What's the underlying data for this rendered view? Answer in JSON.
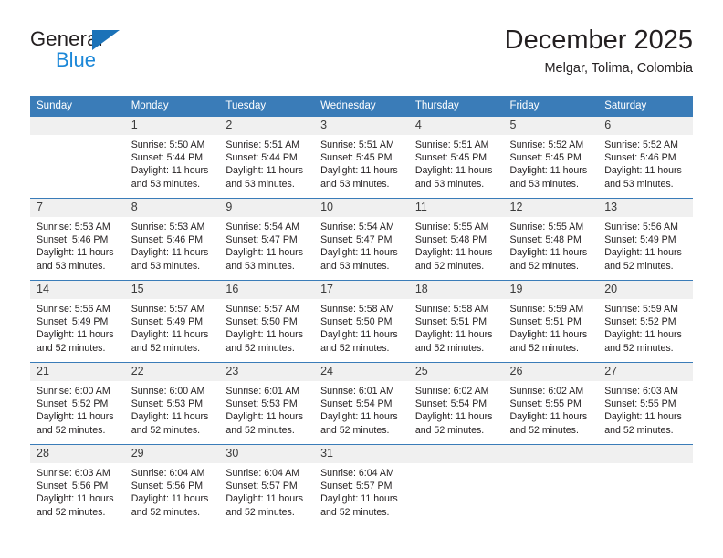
{
  "brand": {
    "name_top": "General",
    "name_bottom": "Blue",
    "accent_color": "#1b72b8",
    "accent_color_light": "#1b87d8"
  },
  "header": {
    "title": "December 2025",
    "subtitle": "Melgar, Tolima, Colombia"
  },
  "calendar": {
    "header_bg": "#3a7cb8",
    "daynum_bg": "#f0f0f0",
    "weekday_headers": [
      "Sunday",
      "Monday",
      "Tuesday",
      "Wednesday",
      "Thursday",
      "Friday",
      "Saturday"
    ],
    "weeks": [
      [
        {
          "day": ""
        },
        {
          "day": "1",
          "sunrise": "Sunrise: 5:50 AM",
          "sunset": "Sunset: 5:44 PM",
          "daylight_line1": "Daylight: 11 hours",
          "daylight_line2": "and 53 minutes."
        },
        {
          "day": "2",
          "sunrise": "Sunrise: 5:51 AM",
          "sunset": "Sunset: 5:44 PM",
          "daylight_line1": "Daylight: 11 hours",
          "daylight_line2": "and 53 minutes."
        },
        {
          "day": "3",
          "sunrise": "Sunrise: 5:51 AM",
          "sunset": "Sunset: 5:45 PM",
          "daylight_line1": "Daylight: 11 hours",
          "daylight_line2": "and 53 minutes."
        },
        {
          "day": "4",
          "sunrise": "Sunrise: 5:51 AM",
          "sunset": "Sunset: 5:45 PM",
          "daylight_line1": "Daylight: 11 hours",
          "daylight_line2": "and 53 minutes."
        },
        {
          "day": "5",
          "sunrise": "Sunrise: 5:52 AM",
          "sunset": "Sunset: 5:45 PM",
          "daylight_line1": "Daylight: 11 hours",
          "daylight_line2": "and 53 minutes."
        },
        {
          "day": "6",
          "sunrise": "Sunrise: 5:52 AM",
          "sunset": "Sunset: 5:46 PM",
          "daylight_line1": "Daylight: 11 hours",
          "daylight_line2": "and 53 minutes."
        }
      ],
      [
        {
          "day": "7",
          "sunrise": "Sunrise: 5:53 AM",
          "sunset": "Sunset: 5:46 PM",
          "daylight_line1": "Daylight: 11 hours",
          "daylight_line2": "and 53 minutes."
        },
        {
          "day": "8",
          "sunrise": "Sunrise: 5:53 AM",
          "sunset": "Sunset: 5:46 PM",
          "daylight_line1": "Daylight: 11 hours",
          "daylight_line2": "and 53 minutes."
        },
        {
          "day": "9",
          "sunrise": "Sunrise: 5:54 AM",
          "sunset": "Sunset: 5:47 PM",
          "daylight_line1": "Daylight: 11 hours",
          "daylight_line2": "and 53 minutes."
        },
        {
          "day": "10",
          "sunrise": "Sunrise: 5:54 AM",
          "sunset": "Sunset: 5:47 PM",
          "daylight_line1": "Daylight: 11 hours",
          "daylight_line2": "and 53 minutes."
        },
        {
          "day": "11",
          "sunrise": "Sunrise: 5:55 AM",
          "sunset": "Sunset: 5:48 PM",
          "daylight_line1": "Daylight: 11 hours",
          "daylight_line2": "and 52 minutes."
        },
        {
          "day": "12",
          "sunrise": "Sunrise: 5:55 AM",
          "sunset": "Sunset: 5:48 PM",
          "daylight_line1": "Daylight: 11 hours",
          "daylight_line2": "and 52 minutes."
        },
        {
          "day": "13",
          "sunrise": "Sunrise: 5:56 AM",
          "sunset": "Sunset: 5:49 PM",
          "daylight_line1": "Daylight: 11 hours",
          "daylight_line2": "and 52 minutes."
        }
      ],
      [
        {
          "day": "14",
          "sunrise": "Sunrise: 5:56 AM",
          "sunset": "Sunset: 5:49 PM",
          "daylight_line1": "Daylight: 11 hours",
          "daylight_line2": "and 52 minutes."
        },
        {
          "day": "15",
          "sunrise": "Sunrise: 5:57 AM",
          "sunset": "Sunset: 5:49 PM",
          "daylight_line1": "Daylight: 11 hours",
          "daylight_line2": "and 52 minutes."
        },
        {
          "day": "16",
          "sunrise": "Sunrise: 5:57 AM",
          "sunset": "Sunset: 5:50 PM",
          "daylight_line1": "Daylight: 11 hours",
          "daylight_line2": "and 52 minutes."
        },
        {
          "day": "17",
          "sunrise": "Sunrise: 5:58 AM",
          "sunset": "Sunset: 5:50 PM",
          "daylight_line1": "Daylight: 11 hours",
          "daylight_line2": "and 52 minutes."
        },
        {
          "day": "18",
          "sunrise": "Sunrise: 5:58 AM",
          "sunset": "Sunset: 5:51 PM",
          "daylight_line1": "Daylight: 11 hours",
          "daylight_line2": "and 52 minutes."
        },
        {
          "day": "19",
          "sunrise": "Sunrise: 5:59 AM",
          "sunset": "Sunset: 5:51 PM",
          "daylight_line1": "Daylight: 11 hours",
          "daylight_line2": "and 52 minutes."
        },
        {
          "day": "20",
          "sunrise": "Sunrise: 5:59 AM",
          "sunset": "Sunset: 5:52 PM",
          "daylight_line1": "Daylight: 11 hours",
          "daylight_line2": "and 52 minutes."
        }
      ],
      [
        {
          "day": "21",
          "sunrise": "Sunrise: 6:00 AM",
          "sunset": "Sunset: 5:52 PM",
          "daylight_line1": "Daylight: 11 hours",
          "daylight_line2": "and 52 minutes."
        },
        {
          "day": "22",
          "sunrise": "Sunrise: 6:00 AM",
          "sunset": "Sunset: 5:53 PM",
          "daylight_line1": "Daylight: 11 hours",
          "daylight_line2": "and 52 minutes."
        },
        {
          "day": "23",
          "sunrise": "Sunrise: 6:01 AM",
          "sunset": "Sunset: 5:53 PM",
          "daylight_line1": "Daylight: 11 hours",
          "daylight_line2": "and 52 minutes."
        },
        {
          "day": "24",
          "sunrise": "Sunrise: 6:01 AM",
          "sunset": "Sunset: 5:54 PM",
          "daylight_line1": "Daylight: 11 hours",
          "daylight_line2": "and 52 minutes."
        },
        {
          "day": "25",
          "sunrise": "Sunrise: 6:02 AM",
          "sunset": "Sunset: 5:54 PM",
          "daylight_line1": "Daylight: 11 hours",
          "daylight_line2": "and 52 minutes."
        },
        {
          "day": "26",
          "sunrise": "Sunrise: 6:02 AM",
          "sunset": "Sunset: 5:55 PM",
          "daylight_line1": "Daylight: 11 hours",
          "daylight_line2": "and 52 minutes."
        },
        {
          "day": "27",
          "sunrise": "Sunrise: 6:03 AM",
          "sunset": "Sunset: 5:55 PM",
          "daylight_line1": "Daylight: 11 hours",
          "daylight_line2": "and 52 minutes."
        }
      ],
      [
        {
          "day": "28",
          "sunrise": "Sunrise: 6:03 AM",
          "sunset": "Sunset: 5:56 PM",
          "daylight_line1": "Daylight: 11 hours",
          "daylight_line2": "and 52 minutes."
        },
        {
          "day": "29",
          "sunrise": "Sunrise: 6:04 AM",
          "sunset": "Sunset: 5:56 PM",
          "daylight_line1": "Daylight: 11 hours",
          "daylight_line2": "and 52 minutes."
        },
        {
          "day": "30",
          "sunrise": "Sunrise: 6:04 AM",
          "sunset": "Sunset: 5:57 PM",
          "daylight_line1": "Daylight: 11 hours",
          "daylight_line2": "and 52 minutes."
        },
        {
          "day": "31",
          "sunrise": "Sunrise: 6:04 AM",
          "sunset": "Sunset: 5:57 PM",
          "daylight_line1": "Daylight: 11 hours",
          "daylight_line2": "and 52 minutes."
        },
        {
          "day": ""
        },
        {
          "day": ""
        },
        {
          "day": ""
        }
      ]
    ]
  }
}
